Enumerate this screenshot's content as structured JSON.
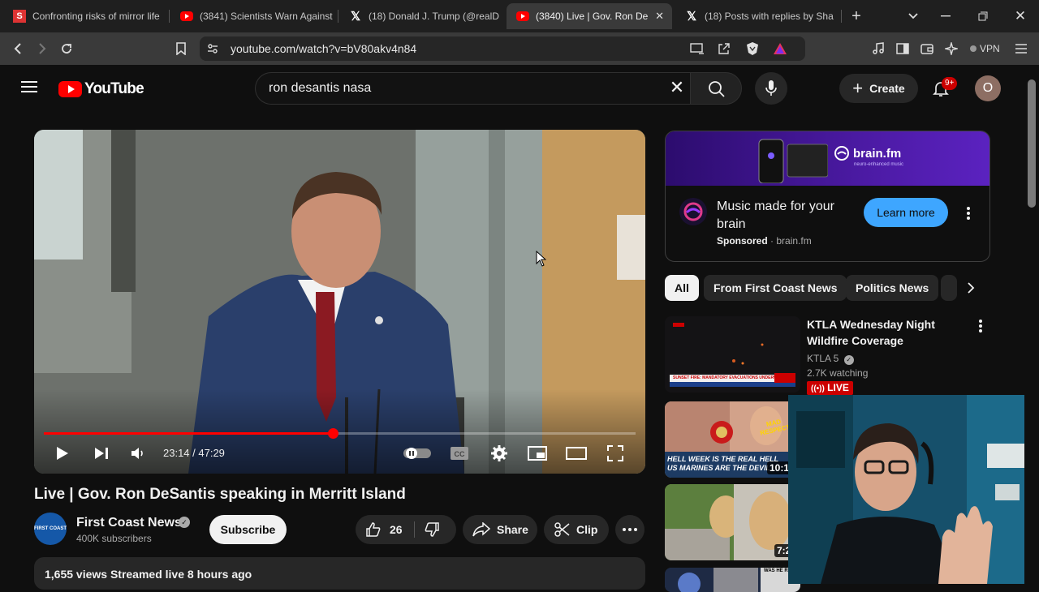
{
  "browser": {
    "tabs": [
      {
        "title": "Confronting risks of mirror life",
        "icon": "substack-icon",
        "fav": "S"
      },
      {
        "title": "(3841) Scientists Warn Against",
        "icon": "youtube-icon"
      },
      {
        "title": "(18) Donald J. Trump (@realD",
        "icon": "x-icon"
      },
      {
        "title": "(3840) Live | Gov. Ron De",
        "icon": "youtube-icon",
        "active": true
      },
      {
        "title": "(18) Posts with replies by Sha",
        "icon": "x-icon"
      }
    ],
    "url": "youtube.com/watch?v=bV80akv4n84",
    "vpn_label": "VPN"
  },
  "youtube": {
    "logo_text": "YouTube",
    "search": {
      "value": "ron desantis nasa"
    },
    "create_label": "Create",
    "notification_count": "9+",
    "avatar_letter": "O"
  },
  "player": {
    "time_current": "23:14",
    "time_total": "47:29",
    "time_display": "23:14 / 47:29",
    "progress_fraction": 0.489
  },
  "video": {
    "title": "Live | Gov. Ron DeSantis speaking in Merritt Island",
    "channel": "First Coast News",
    "channel_logo_text": "FIRST COAST NEWS",
    "subscribers": "400K subscribers",
    "subscribe_label": "Subscribe",
    "likes": "26",
    "share_label": "Share",
    "clip_label": "Clip",
    "meta": "1,655 views  Streamed live 8 hours ago"
  },
  "ad": {
    "banner_brand": "brain.fm",
    "banner_tagline": "neuro-enhanced music",
    "title": "Music made for your brain",
    "sponsored": "Sponsored",
    "domain": "brain.fm",
    "cta": "Learn more"
  },
  "chips": [
    "All",
    "From First Coast News",
    "Politics News"
  ],
  "recommendations": [
    {
      "title": "KTLA Wednesday Night Wildfire Coverage",
      "channel": "KTLA 5",
      "watching": "2.7K watching",
      "live": "LIVE",
      "thumb_ticker": "SUNSET FIRE: MANDATORY EVACUATIONS UNDERWAY"
    },
    {
      "thumb_caption": "HELL WEEK IS THE REAL HELL US MARINES ARE THE DEVIL",
      "thumb_badge": "MAD RESPECT",
      "duration": "10:1"
    },
    {
      "duration": "7:2"
    },
    {
      "thumb_text": "WAS HE R"
    }
  ]
}
